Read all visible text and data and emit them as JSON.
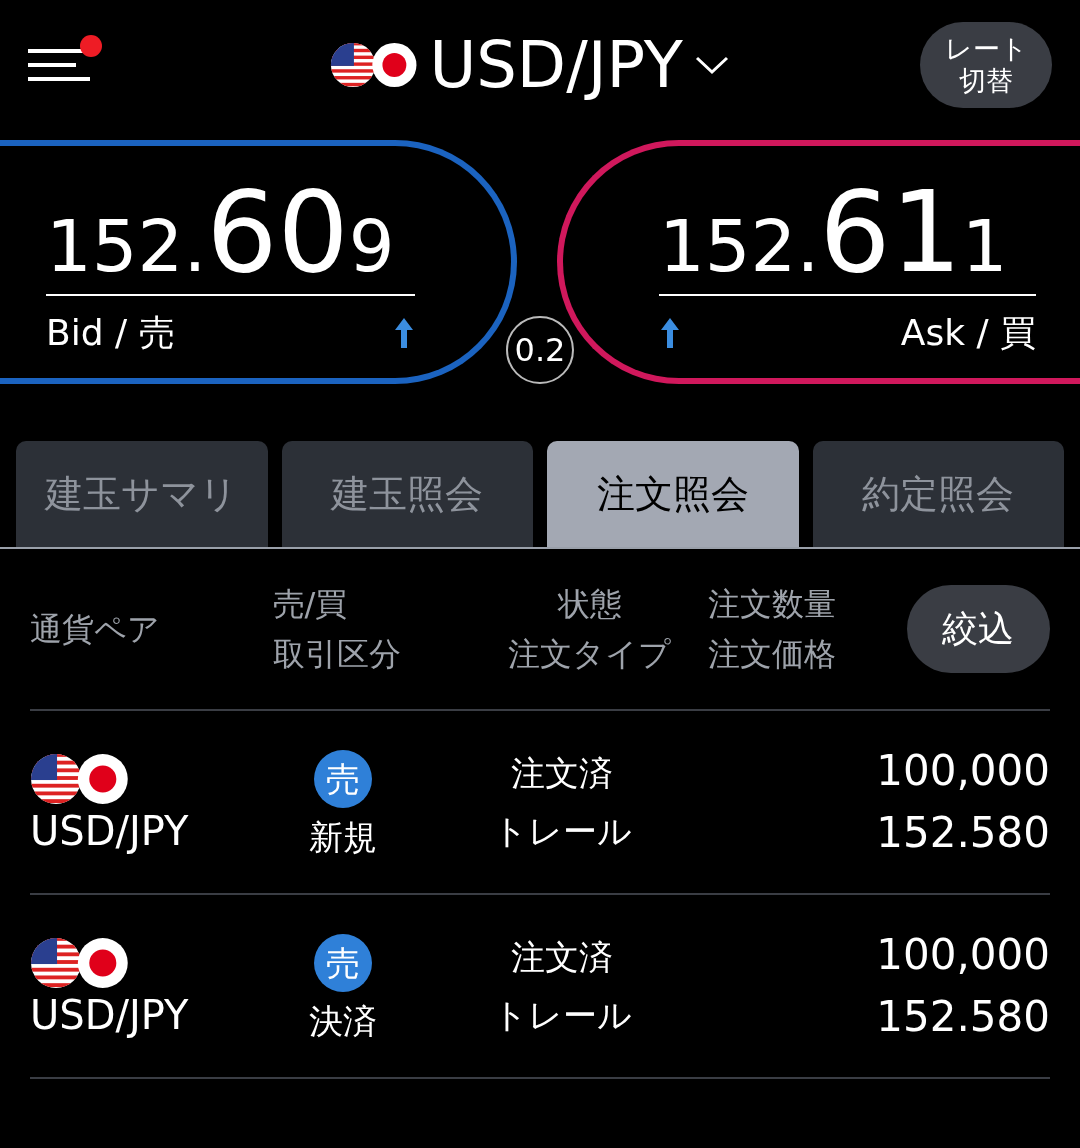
{
  "header": {
    "notification": true,
    "pair": "USD/JPY",
    "rate_button": [
      "レート",
      "切替"
    ]
  },
  "quotes": [
    {
      "kind": "bid",
      "prefix": "152.",
      "big": "60",
      "suffix": "9",
      "label": "Bid / 売"
    },
    {
      "kind": "ask",
      "prefix": "152.",
      "big": "61",
      "suffix": "1",
      "label": "Ask / 買"
    }
  ],
  "spread": "0.2",
  "tabs": [
    {
      "label": "建玉サマリ",
      "selected": false
    },
    {
      "label": "建玉照会",
      "selected": false
    },
    {
      "label": "注文照会",
      "selected": true
    },
    {
      "label": "約定照会",
      "selected": false
    }
  ],
  "columns": [
    [
      "通貨ペア"
    ],
    [
      "売/買",
      "取引区分"
    ],
    [
      "状態",
      "注文タイプ"
    ],
    [
      "注文数量",
      "注文価格"
    ]
  ],
  "filter_button": "絞込",
  "rows": [
    {
      "pair": "USD/JPY",
      "side": "売",
      "trade_type": "新規",
      "status": "注文済",
      "order_type": "トレール",
      "quantity": "100,000",
      "price": "152.580"
    },
    {
      "pair": "USD/JPY",
      "side": "売",
      "trade_type": "決済",
      "status": "注文済",
      "order_type": "トレール",
      "quantity": "100,000",
      "price": "152.580"
    }
  ]
}
